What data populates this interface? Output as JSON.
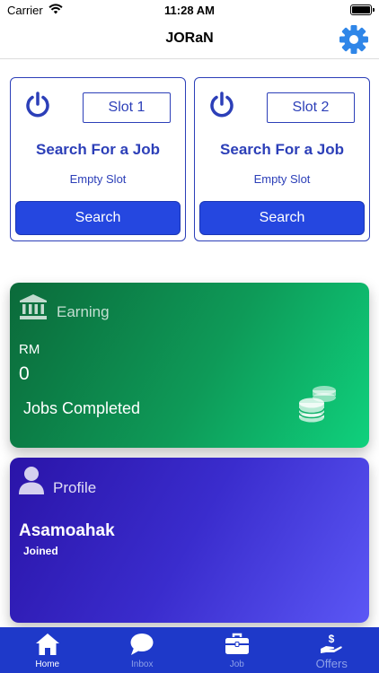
{
  "status_bar": {
    "carrier": "Carrier",
    "time": "11:28 AM"
  },
  "nav": {
    "title": "JORaN",
    "settings_icon": "gear-icon"
  },
  "slots": [
    {
      "slot_label": "Slot 1",
      "heading": "Search For a Job",
      "status": "Empty Slot",
      "button_label": "Search",
      "icon": "power-icon"
    },
    {
      "slot_label": "Slot 2",
      "heading": "Search For a Job",
      "status": "Empty Slot",
      "button_label": "Search",
      "icon": "power-icon"
    }
  ],
  "earning": {
    "title": "Earning",
    "currency": "RM",
    "amount": "0",
    "jobs_label": "Jobs Completed",
    "icon": "bank-icon"
  },
  "profile": {
    "title": "Profile",
    "name": "Asamoahak",
    "joined_label": "Joined",
    "icon": "user-icon"
  },
  "tabs": [
    {
      "label": "Home",
      "icon": "home-icon",
      "active": true
    },
    {
      "label": "Inbox",
      "icon": "chat-icon",
      "active": false
    },
    {
      "label": "Job",
      "icon": "briefcase-icon",
      "active": false
    },
    {
      "label": "Offers",
      "icon": "hand-dollar-icon",
      "active": false
    }
  ],
  "colors": {
    "primary": "#2c3fb8",
    "button": "#2547e0",
    "tab_bar": "#1e39c9",
    "gear": "#2f86e8",
    "earning_gradient": [
      "#0b6a3a",
      "#0fd17d"
    ],
    "profile_gradient": [
      "#2a14a8",
      "#5b57f5"
    ]
  }
}
